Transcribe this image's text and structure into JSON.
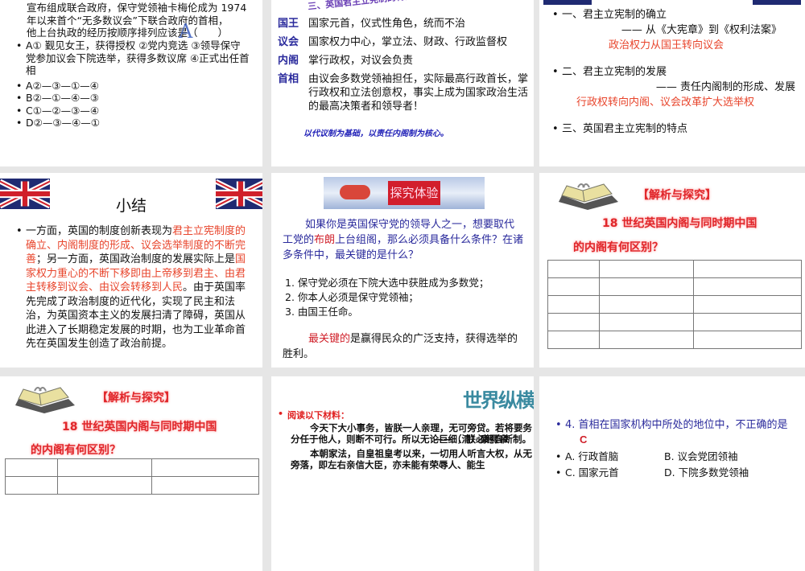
{
  "slides": [
    {
      "intro_lines": [
        "宣布组成联合政府，保守党领袖卡梅伦成为 1974",
        "年以来首个“无多数议会”下联合政府的首相，",
        "他上台执政的经历按顺序排列应该是（　　）"
      ],
      "answer_mark": "A",
      "items": [
        "A① 觐见女王，获得授权 ②党内竞选 ③领导保守党参加议会下院选举，获得多数议席 ④正式出任首相",
        "A②—③—①—④",
        "B②—①—④—③",
        "C①—②—③—④",
        "D②—③—④—①"
      ]
    },
    {
      "title": "三、英国君主立宪制的特点",
      "rows": [
        {
          "term": "国王",
          "desc": "国家元首，仪式性角色，统而不治"
        },
        {
          "term": "议会",
          "desc": "国家权力中心，掌立法、财政、行政监督权"
        },
        {
          "term": "内阁",
          "desc": "掌行政权，对议会负责"
        },
        {
          "term": "首相",
          "desc": "由议会多数党领袖担任，实际最高行政首长，掌行政权和立法创意权，事实上成为国家政治生活的最高决策者和领导者！"
        }
      ],
      "summary": "以代议制为基础，以责任内阁制为核心。"
    },
    {
      "p1": "一、君主立宪制的确立",
      "p1_sub": "—— 从《大宪章》到《权利法案》",
      "p1_red": "政治权力从国王转向议会",
      "p2": "二、君主立宪制的发展",
      "p2_sub": "—— 责任内阁制的形成、发展",
      "p2_red": "行政权转向内阁、议会改革扩大选举权",
      "p3": "三、英国君主立宪制的特点"
    },
    {
      "title": "小结",
      "parts": [
        "一方面，英国的制度创新表现为",
        "君主立宪制度的确立、内阁制度的形成、议会选举制度的不断完善",
        "；另一方面，英国政治制度的发展实际上是",
        "国家权力重心的不断下移即由上帝移到君主、由君主转移到议会、由议会转移到人民",
        "。由于英国率先完成了政治制度的近代化，实现了民主和法治，为英国资本主义的发展扫清了障碍，英国从此进入了长期稳定发展的时期，也为工业革命首先在英国发生创造了政治前提。"
      ]
    },
    {
      "banner": "探究体验",
      "q_a": "如果你是英国保守党的领导人之一，想要取代工党的",
      "q_name": "布朗",
      "q_b": "上台组阁，那么必须具备什么条件？在诸多条件中，最关键的是什么？",
      "answers": [
        "1. 保守党必须在下院大选中获胜成为多数党；",
        "2. 你本人必须是保守党领袖；",
        "3. 由国王任命。"
      ],
      "key_red": "最关键的",
      "key_rest": "是赢得民众的广泛支持，获得选举的胜利。"
    },
    {
      "heading": "【解析与探究】",
      "q1": "18 世纪英国内阁与同时期中国",
      "q2": "的内阁有何区别？"
    },
    {
      "heading": "【解析与探究】",
      "q1": "18 世纪英国内阁与同时期中国",
      "q2": "的内阁有何区别？"
    },
    {
      "wordart": "世界纵横",
      "label": "阅读以下材料：",
      "para1": "今天下大小事务，皆朕一人亲理，无可旁贷。若将要务分任于他人，则断不可行。所以无论巨细，朕必躬自断制。",
      "source1": "——（清）康熙帝",
      "para2": "本朝家法，自皇祖皇考以来，一切用人听言大权，从无旁落，即左右亲信大臣，亦未能有荣辱人、能生"
    },
    {
      "question": "4. 首相在国家机构中所处的地位中，不正确的是",
      "answer": "C",
      "options": [
        "A. 行政首脑",
        "B. 议会党团领袖",
        "C. 国家元首",
        "D. 下院多数党领袖"
      ]
    }
  ],
  "colors": {
    "red": "#e8452c",
    "blue": "#2a2a9c",
    "bg": "#e6e6e6"
  }
}
